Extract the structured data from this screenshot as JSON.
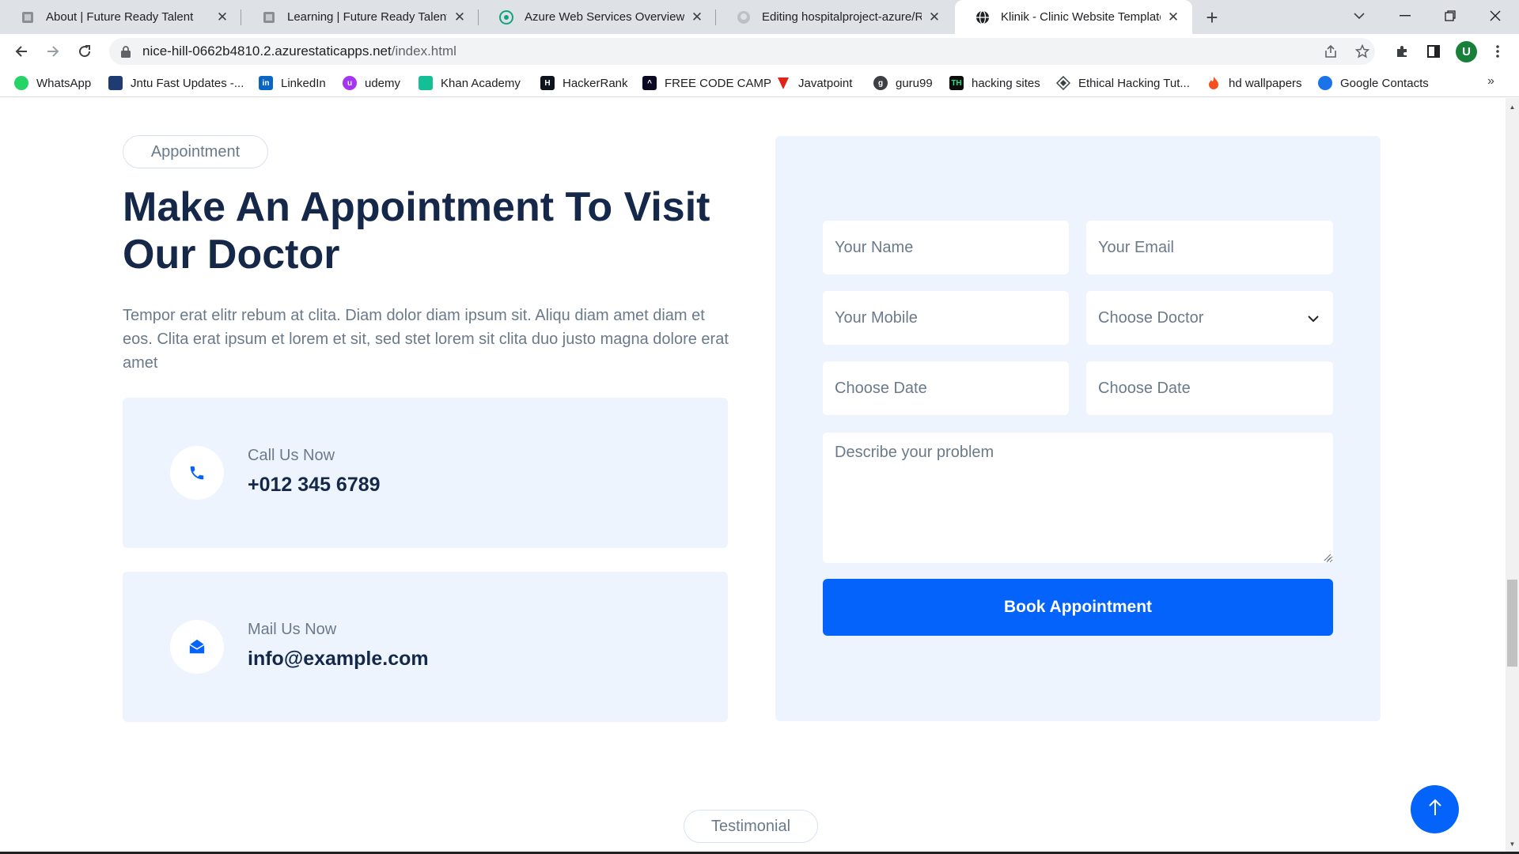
{
  "browser": {
    "tabs": [
      {
        "title": "About | Future Ready Talent"
      },
      {
        "title": "Learning | Future Ready Talent"
      },
      {
        "title": "Azure Web Services Overview"
      },
      {
        "title": "Editing hospitalproject-azure/RE/"
      },
      {
        "title": "Klinik - Clinic Website Template",
        "active": true
      }
    ],
    "url_host": "nice-hill-0662b4810.2.azurestaticapps.net",
    "url_path": "/index.html",
    "profile_initial": "U",
    "bookmarks": [
      "WhatsApp",
      "Jntu Fast Updates -...",
      "LinkedIn",
      "udemy",
      "Khan Academy",
      "HackerRank",
      "FREE CODE CAMP",
      "Javatpoint",
      "guru99",
      "hacking sites",
      "Ethical Hacking Tut...",
      "hd wallpapers",
      "Google Contacts"
    ],
    "bookmark_more": "»"
  },
  "appointment": {
    "badge": "Appointment",
    "heading": "Make An Appointment To Visit Our Doctor",
    "description": "Tempor erat elitr rebum at clita. Diam dolor diam ipsum sit. Aliqu diam amet diam et eos. Clita erat ipsum et lorem et sit, sed stet lorem sit clita duo justo magna dolore erat amet",
    "call": {
      "label": "Call Us Now",
      "value": "+012 345 6789"
    },
    "mail": {
      "label": "Mail Us Now",
      "value": "info@example.com"
    }
  },
  "form": {
    "name_placeholder": "Your Name",
    "email_placeholder": "Your Email",
    "mobile_placeholder": "Your Mobile",
    "doctor_select": "Choose Doctor",
    "date_placeholder_1": "Choose Date",
    "date_placeholder_2": "Choose Date",
    "problem_placeholder": "Describe your problem",
    "submit_label": "Book Appointment"
  },
  "testimonial": {
    "badge": "Testimonial"
  },
  "colors": {
    "primary": "#0463fa",
    "heading": "#15284a",
    "panel": "#eef4fd",
    "muted": "#6b7a8a"
  }
}
